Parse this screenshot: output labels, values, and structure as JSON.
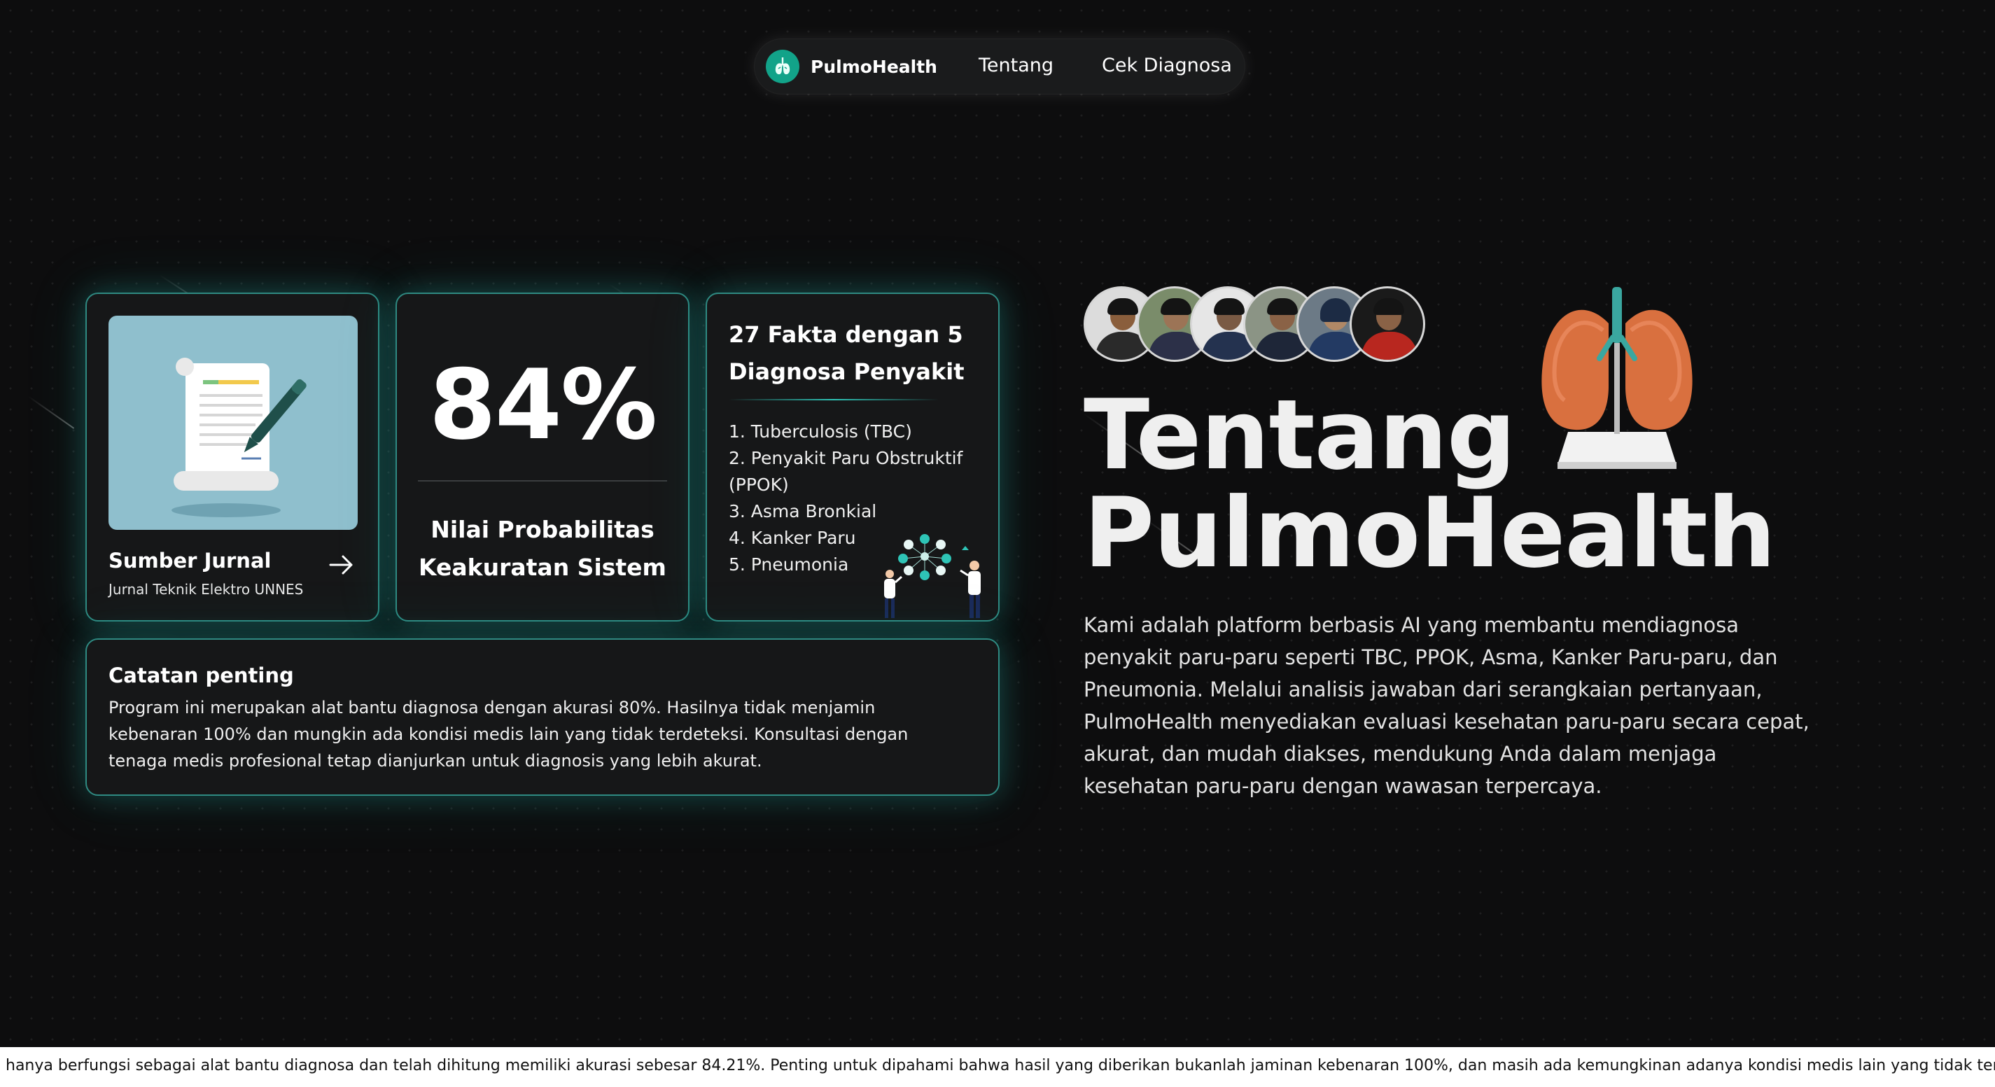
{
  "nav": {
    "logo_icon": "lungs-icon",
    "brand": "PulmoHealth",
    "links": [
      "Tentang",
      "Cek Diagnosa"
    ]
  },
  "cards": {
    "source": {
      "title": "Sumber Jurnal",
      "subtitle": "Jurnal Teknik Elektro UNNES",
      "image_icon": "document-signing-illustration",
      "arrow_icon": "arrow-right-icon"
    },
    "accuracy": {
      "value": "84%",
      "label_line1": "Nilai Probabilitas",
      "label_line2": "Keakuratan Sistem"
    },
    "facts": {
      "title_line1": "27 Fakta dengan 5",
      "title_line2": "Diagnosa Penyakit",
      "items": [
        "1. Tuberculosis (TBC)",
        "2. Penyakit Paru Obstruktif (PPOK)",
        "3. Asma Bronkial",
        "4. Kanker Paru",
        "5. Pneumonia"
      ],
      "illustration_icon": "team-network-illustration"
    },
    "note": {
      "title": "Catatan penting",
      "body": "Program ini merupakan alat bantu diagnosa dengan akurasi 80%. Hasilnya tidak menjamin kebenaran 100% dan mungkin ada kondisi medis lain yang tidak terdeteksi. Konsultasi dengan tenaga medis profesional tetap dianjurkan untuk diagnosis yang lebih akurat."
    }
  },
  "hero": {
    "title_line1": "Tentang",
    "title_line2": "PulmoHealth",
    "description": "Kami adalah platform berbasis AI yang membantu mendiagnosa penyakit paru-paru seperti TBC, PPOK, Asma, Kanker Paru-paru, dan Pneumonia. Melalui analisis jawaban dari serangkaian pertanyaan, PulmoHealth menyediakan evaluasi kesehatan paru-paru secara cepat, akurat, dan mudah diakses, mendukung Anda dalam menjaga kesehatan paru-paru dengan wawasan terpercaya.",
    "team_avatar_count": 6,
    "lungs_icon": "lungs-model-illustration"
  },
  "ticker": {
    "text": "hanya berfungsi sebagai alat bantu diagnosa dan telah dihitung memiliki akurasi sebesar 84.21%. Penting untuk dipahami bahwa hasil yang diberikan bukanlah jaminan kebenaran 100%, dan masih ada kemungkinan adanya kondisi medis lain yang tidak terdeteksi oleh program ini"
  },
  "colors": {
    "background": "#0d0d0e",
    "card": "#161718",
    "accent_teal": "#2ec4b6",
    "logo_green": "#12a389"
  }
}
